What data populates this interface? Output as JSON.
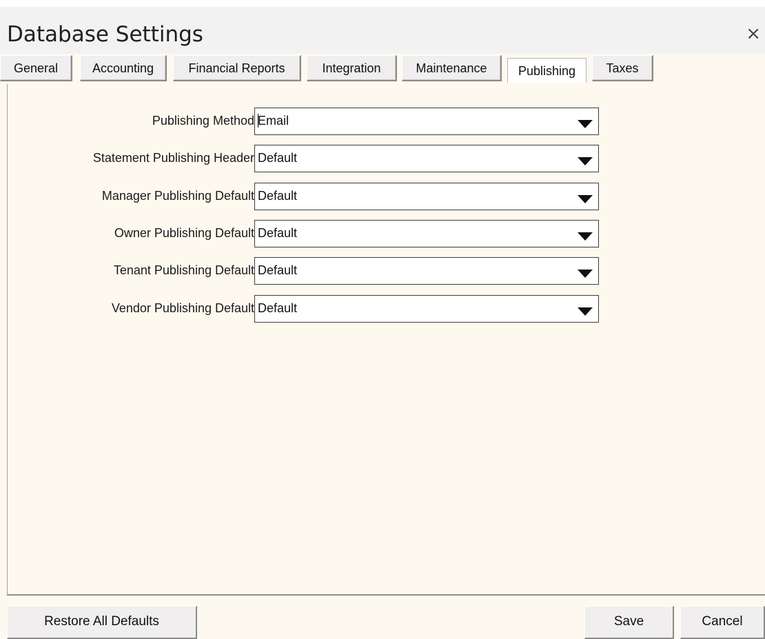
{
  "window": {
    "title": "Database Settings",
    "close_glyph": "×"
  },
  "tabs": [
    {
      "label": "General",
      "active": false
    },
    {
      "label": "Accounting",
      "active": false
    },
    {
      "label": "Financial Reports",
      "active": false
    },
    {
      "label": "Integration",
      "active": false
    },
    {
      "label": "Maintenance",
      "active": false
    },
    {
      "label": "Publishing",
      "active": true
    },
    {
      "label": "Taxes",
      "active": false
    }
  ],
  "fields": [
    {
      "label": "Publishing Method",
      "value": "Email"
    },
    {
      "label": "Statement Publishing Header",
      "value": "Default"
    },
    {
      "label": "Manager Publishing Default",
      "value": "Default"
    },
    {
      "label": "Owner Publishing Default",
      "value": "Default"
    },
    {
      "label": "Tenant Publishing Default",
      "value": "Default"
    },
    {
      "label": "Vendor Publishing Default",
      "value": "Default"
    }
  ],
  "footer": {
    "restore_label": "Restore All Defaults",
    "save_label": "Save",
    "cancel_label": "Cancel"
  },
  "icons": {
    "close": "close-icon",
    "dropdown": "dropdown-arrow-icon"
  },
  "colors": {
    "panel_background": "#fdf9ef",
    "title_background": "#f3f2f3",
    "button_face": "#f0eeee"
  }
}
